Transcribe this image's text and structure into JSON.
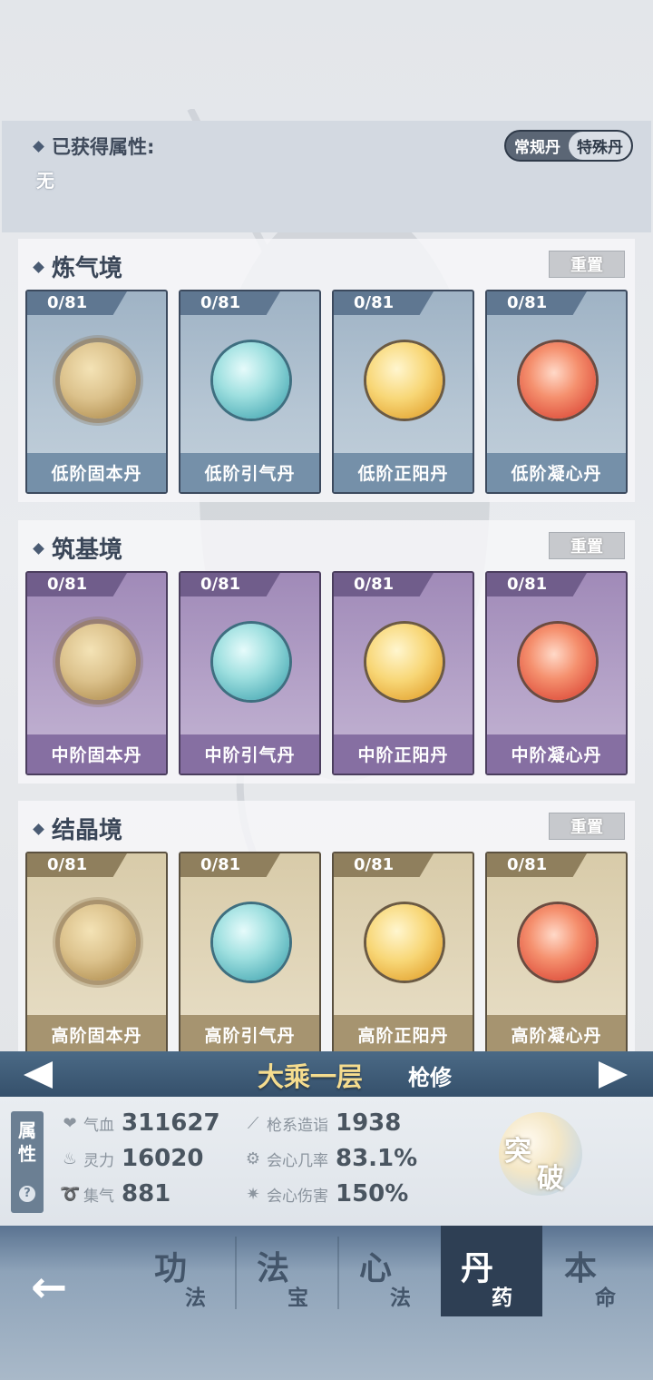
{
  "attributes": {
    "title": "已获得属性:",
    "value": "无",
    "toggle": [
      "常规丹",
      "特殊丹"
    ],
    "active_toggle": 0
  },
  "reset_label": "重置",
  "sections": [
    {
      "title": "炼气境",
      "tier": "blue",
      "pills": [
        {
          "count": "0/81",
          "name": "低阶固本丹",
          "orb": "gu"
        },
        {
          "count": "0/81",
          "name": "低阶引气丹",
          "orb": "yin"
        },
        {
          "count": "0/81",
          "name": "低阶正阳丹",
          "orb": "yang"
        },
        {
          "count": "0/81",
          "name": "低阶凝心丹",
          "orb": "ning"
        }
      ]
    },
    {
      "title": "筑基境",
      "tier": "purple",
      "pills": [
        {
          "count": "0/81",
          "name": "中阶固本丹",
          "orb": "gu"
        },
        {
          "count": "0/81",
          "name": "中阶引气丹",
          "orb": "yin"
        },
        {
          "count": "0/81",
          "name": "中阶正阳丹",
          "orb": "yang"
        },
        {
          "count": "0/81",
          "name": "中阶凝心丹",
          "orb": "ning"
        }
      ]
    },
    {
      "title": "结晶境",
      "tier": "gold",
      "pills": [
        {
          "count": "0/81",
          "name": "高阶固本丹",
          "orb": "gu"
        },
        {
          "count": "0/81",
          "name": "高阶引气丹",
          "orb": "yin"
        },
        {
          "count": "0/81",
          "name": "高阶正阳丹",
          "orb": "yang"
        },
        {
          "count": "0/81",
          "name": "高阶凝心丹",
          "orb": "ning"
        }
      ]
    }
  ],
  "realm": {
    "name": "大乘一层",
    "class": "枪修"
  },
  "stats": {
    "tab_label": "属性",
    "help": "?",
    "items": [
      {
        "icon": "heart-icon",
        "glyph": "❤",
        "name": "气血",
        "value": "311627"
      },
      {
        "icon": "spear-icon",
        "glyph": "⟋",
        "name": "枪系造诣",
        "value": "1938"
      },
      {
        "icon": "flame-icon",
        "glyph": "♨",
        "name": "灵力",
        "value": "16020"
      },
      {
        "icon": "crit-rate-icon",
        "glyph": "⚙",
        "name": "会心几率",
        "value": "83.1%"
      },
      {
        "icon": "swirl-icon",
        "glyph": "➰",
        "name": "集气",
        "value": "881"
      },
      {
        "icon": "crit-damage-icon",
        "glyph": "✷",
        "name": "会心伤害",
        "value": "150%"
      }
    ]
  },
  "breakthrough": {
    "c1": "突",
    "c2": "破"
  },
  "nav": {
    "back_glyph": "←",
    "tabs": [
      {
        "big": "功",
        "small": "法"
      },
      {
        "big": "法",
        "small": "宝"
      },
      {
        "big": "心",
        "small": "法"
      },
      {
        "big": "丹",
        "small": "药"
      },
      {
        "big": "本",
        "small": "命"
      }
    ],
    "active_tab": 3
  }
}
